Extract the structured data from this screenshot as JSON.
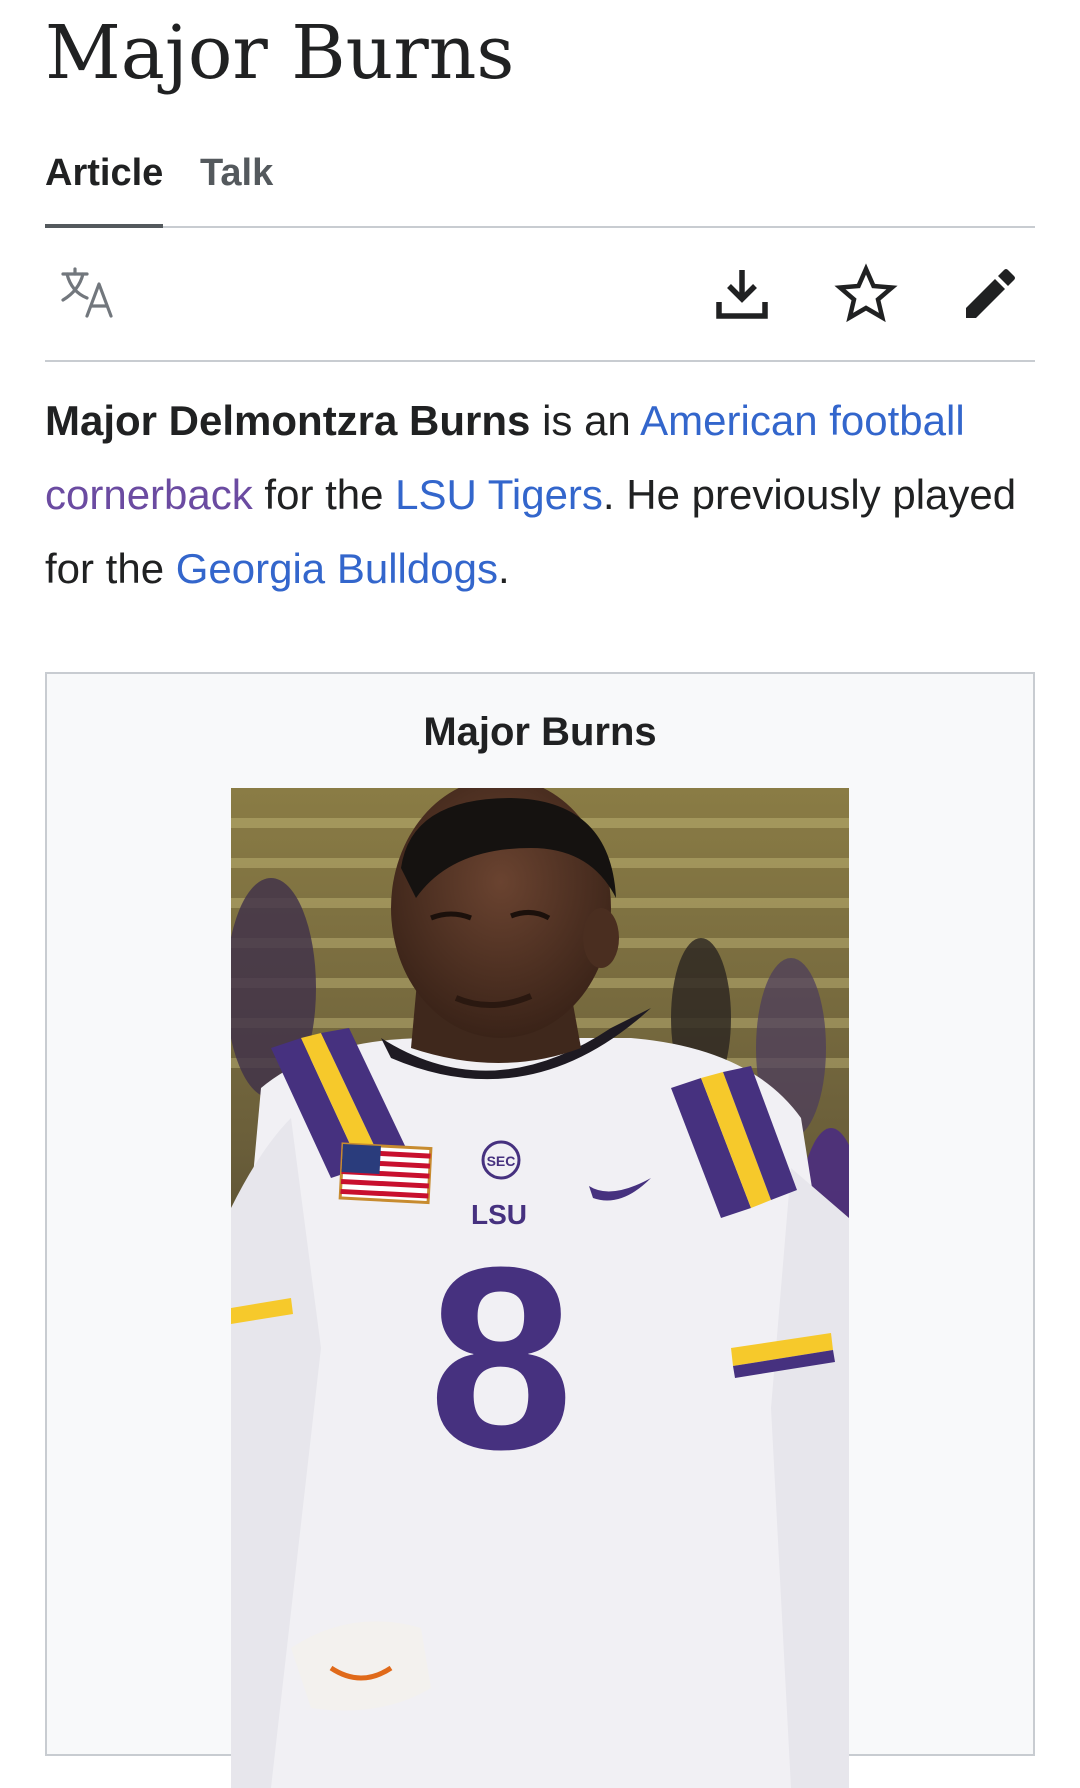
{
  "page": {
    "title": "Major Burns"
  },
  "tabs": [
    {
      "label": "Article",
      "active": true
    },
    {
      "label": "Talk",
      "active": false
    }
  ],
  "toolbar": {
    "icons": [
      "language-icon",
      "download-icon",
      "star-icon",
      "edit-pencil-icon"
    ]
  },
  "lead": {
    "name_bold": "Major Delmontzra Burns",
    "text_1": " is an ",
    "link_american_football": "American football",
    "text_space": " ",
    "link_cornerback": "cornerback",
    "text_2": " for the ",
    "link_lsu_tigers": "LSU Tigers",
    "text_3": ". He previously played for the ",
    "link_georgia_bulldogs": "Georgia Bulldogs",
    "text_4": "."
  },
  "infobox": {
    "title": "Major Burns",
    "jersey_letters": "LSU",
    "jersey_number": "8",
    "conference_patch": "SEC"
  },
  "colors": {
    "link": "#3366cc",
    "link_visited": "#6b4ba1",
    "text": "#202122",
    "muted": "#54595d",
    "border": "#c8ccd1",
    "infobox_bg": "#f8f9fa",
    "lsu_purple": "#46317f",
    "lsu_gold": "#f6c92b"
  }
}
